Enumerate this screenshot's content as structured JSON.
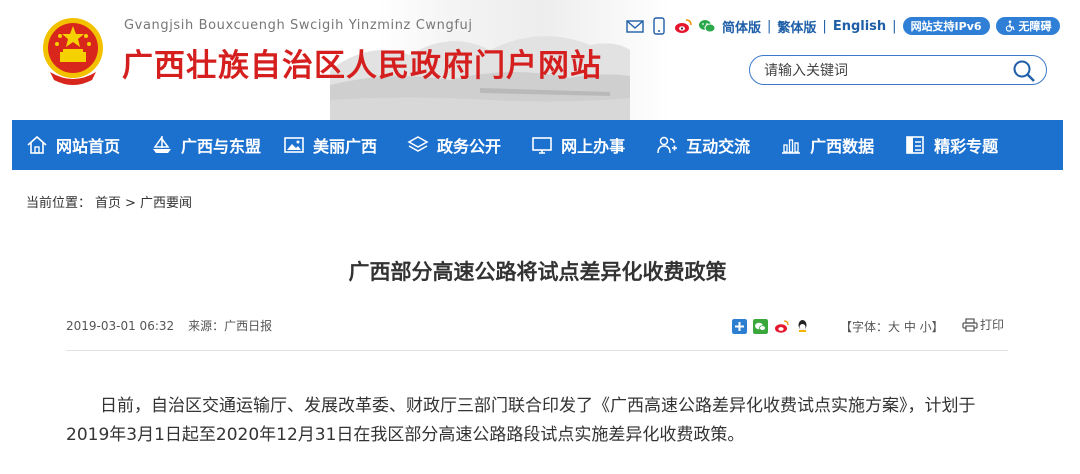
{
  "header": {
    "pinyin": "Gvangjsih Bouxcuengh Swcigih Yinzminz Cwngfuj",
    "site_name": "广西壮族自治区人民政府门户网站",
    "lang_simplified": "简体版",
    "lang_traditional": "繁体版",
    "lang_english": "English",
    "sep": "|",
    "ipv6_badge": "网站支持IPv6",
    "accessible_badge": "无障碍",
    "search_placeholder": "请输入关键词"
  },
  "nav": {
    "items": [
      {
        "label": "网站首页",
        "icon": "home-icon"
      },
      {
        "label": "广西与东盟",
        "icon": "boat-icon"
      },
      {
        "label": "美丽广西",
        "icon": "picture-icon"
      },
      {
        "label": "政务公开",
        "icon": "layers-icon"
      },
      {
        "label": "网上办事",
        "icon": "monitor-icon"
      },
      {
        "label": "互动交流",
        "icon": "users-icon"
      },
      {
        "label": "广西数据",
        "icon": "bar-chart-icon"
      },
      {
        "label": "精彩专题",
        "icon": "topic-icon"
      }
    ]
  },
  "breadcrumb": {
    "prefix": "当前位置：",
    "home": "首页",
    "arrow": ">",
    "section": "广西要闻"
  },
  "article": {
    "title": "广西部分高速公路将试点差异化收费政策",
    "datetime": "2019-03-01 06:32",
    "source": "来源：广西日报",
    "font_size_label": "【字体：大 中 小】",
    "print_label": "打印",
    "paragraph": "日前，自治区交通运输厅、发展改革委、财政厅三部门联合印发了《广西高速公路差异化收费试点实施方案》，计划于2019年3月1日起至2020年12月31日在我区部分高速公路路段试点实施差异化收费政策。"
  },
  "colors": {
    "brand_red": "#d51f1f",
    "nav_blue": "#1c71cf",
    "link_blue": "#1f5fa8"
  }
}
